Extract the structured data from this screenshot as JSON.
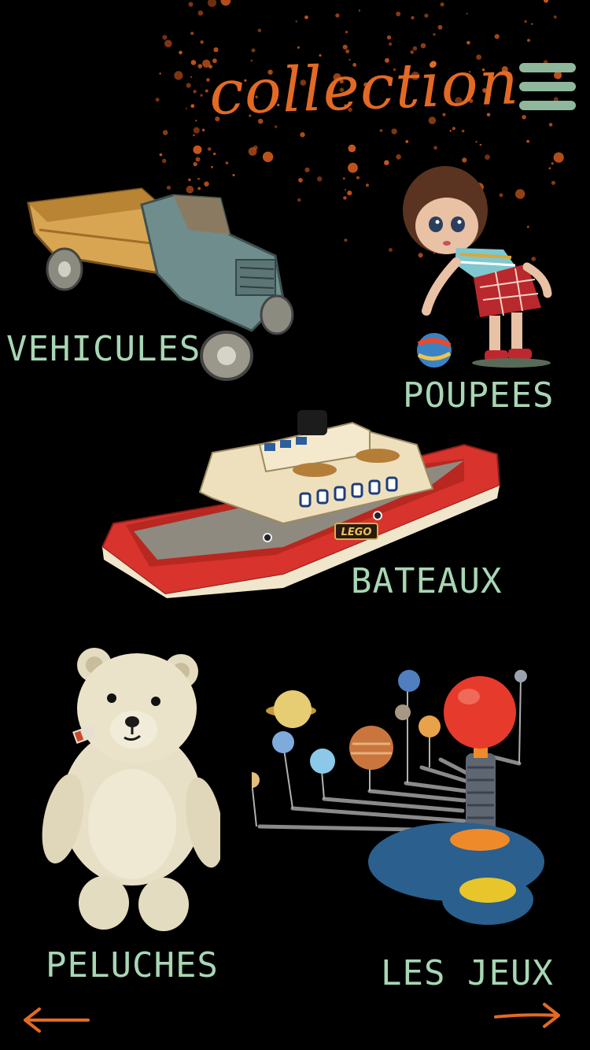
{
  "header": {
    "title": "collection",
    "menu_icon": "hamburger-icon"
  },
  "colors": {
    "background": "#000000",
    "accent_orange": "#e26a24",
    "label_green": "#a8d6b5",
    "menu_green": "#8fb79c"
  },
  "categories": [
    {
      "id": "vehicules",
      "label": "VEHICULES",
      "image": "toy-truck-image"
    },
    {
      "id": "poupees",
      "label": "POUPEES",
      "image": "doll-image"
    },
    {
      "id": "bateaux",
      "label": "BATEAUX",
      "image": "toy-ferry-boat-image",
      "boat_badge": "LEGO"
    },
    {
      "id": "peluches",
      "label": "PELUCHES",
      "image": "teddy-bear-image"
    },
    {
      "id": "jeux",
      "label": "LES JEUX",
      "image": "solar-system-model-image"
    }
  ],
  "navigation": {
    "prev_icon": "arrow-left-icon",
    "next_icon": "arrow-right-icon"
  }
}
